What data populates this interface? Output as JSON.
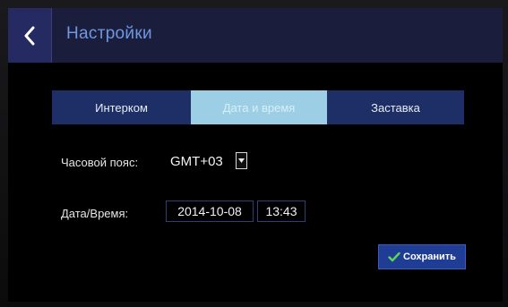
{
  "header": {
    "title": "Настройки",
    "back_icon": "chevron-left-icon"
  },
  "tabs": [
    {
      "label": "Интерком",
      "active": false
    },
    {
      "label": "Дата и время",
      "active": true
    },
    {
      "label": "Заставка",
      "active": false
    }
  ],
  "form": {
    "timezone": {
      "label": "Часовой пояс:",
      "value": "GMT+03"
    },
    "datetime": {
      "label": "Дата/Время:",
      "date": "2014-10-08",
      "time": "13:43"
    }
  },
  "save_button": {
    "label": "Сохранить",
    "icon": "check-icon"
  },
  "colors": {
    "header_bg": "#1a1d3c",
    "title": "#6f97e2",
    "tab_bg": "#1e2f67",
    "tab_active_bg": "#9ccfe6",
    "accent_check": "#5fd35f"
  }
}
